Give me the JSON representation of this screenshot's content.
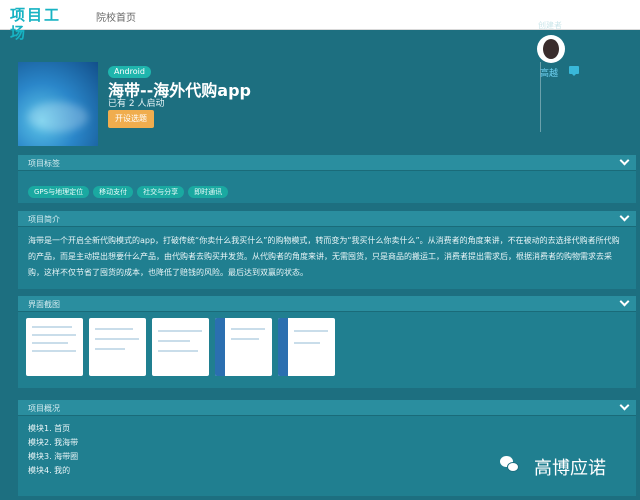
{
  "nav": {
    "logo": "项目工场",
    "school_home": "院校首页"
  },
  "project": {
    "badge": "Android",
    "title": "海带--海外代购app",
    "started": "已有 2 人启动",
    "start_button": "开设选题",
    "creator_label": "创建者",
    "creator_name": "高越"
  },
  "sections": {
    "tags_title": "项目标签",
    "intro_title": "项目简介",
    "screens_title": "界面截图",
    "overview_title": "项目概况"
  },
  "tags": [
    "GPS与地理定位",
    "移动支付",
    "社交与分享",
    "即时通讯"
  ],
  "intro": "海带是一个开启全新代购模式的app，打破传统“你卖什么我买什么”的购物模式，转而变为“我买什么你卖什么”。从消费者的角度来讲，不在被动的去选择代购者所代购的产品，而是主动提出想要什么产品，由代购者去购买并发货。从代购者的角度来讲，无需囤货，只是商品的搬运工，消费者提出需求后，根据消费者的购物需求去采购，这样不仅节省了囤货的成本，也降低了赔钱的风险。最后达到双赢的状态。",
  "modules": [
    "模块1. 首页",
    "模块2. 我海带",
    "模块3. 海带圈",
    "模块4. 我的"
  ],
  "watermark": "高博应诺",
  "colors": {
    "background": "#1d6f80",
    "panel": "#207f90",
    "accent_button": "#f0ad4e",
    "badge": "#1fb5ad"
  }
}
